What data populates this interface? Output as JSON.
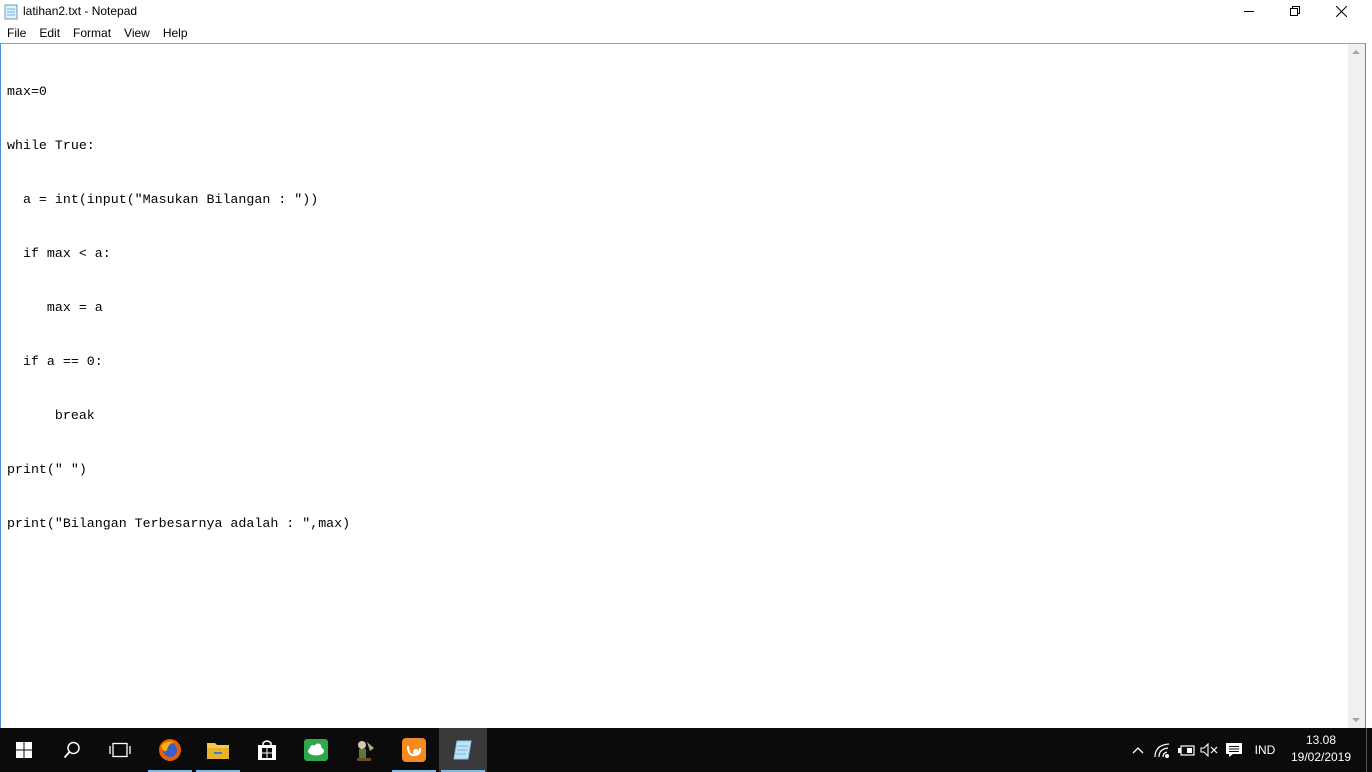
{
  "window": {
    "title": "latihan2.txt - Notepad",
    "icon": "notepad-icon"
  },
  "menu": [
    {
      "label": "File"
    },
    {
      "label": "Edit"
    },
    {
      "label": "Format"
    },
    {
      "label": "View"
    },
    {
      "label": "Help"
    }
  ],
  "editor": {
    "lines": [
      "max=0",
      "while True:",
      "  a = int(input(\"Masukan Bilangan : \"))",
      "  if max < a:",
      "     max = a",
      "  if a == 0:",
      "      break",
      "print(\" \")",
      "print(\"Bilangan Terbesarnya adalah : \",max)"
    ]
  },
  "taskbar": {
    "pinned": [
      {
        "name": "start-icon"
      },
      {
        "name": "search-icon"
      },
      {
        "name": "task-view-icon"
      },
      {
        "name": "firefox-icon"
      },
      {
        "name": "file-explorer-icon"
      },
      {
        "name": "store-icon"
      },
      {
        "name": "cloud-app-icon"
      },
      {
        "name": "game-app-icon"
      },
      {
        "name": "uc-browser-icon"
      },
      {
        "name": "notepad-icon"
      }
    ],
    "tray": {
      "language": "IND",
      "time": "13.08",
      "date": "19/02/2019"
    }
  },
  "colors": {
    "taskbar_bg": "#0b0b0b",
    "accent": "#76b9ed",
    "editor_border": "#4a90d9"
  }
}
